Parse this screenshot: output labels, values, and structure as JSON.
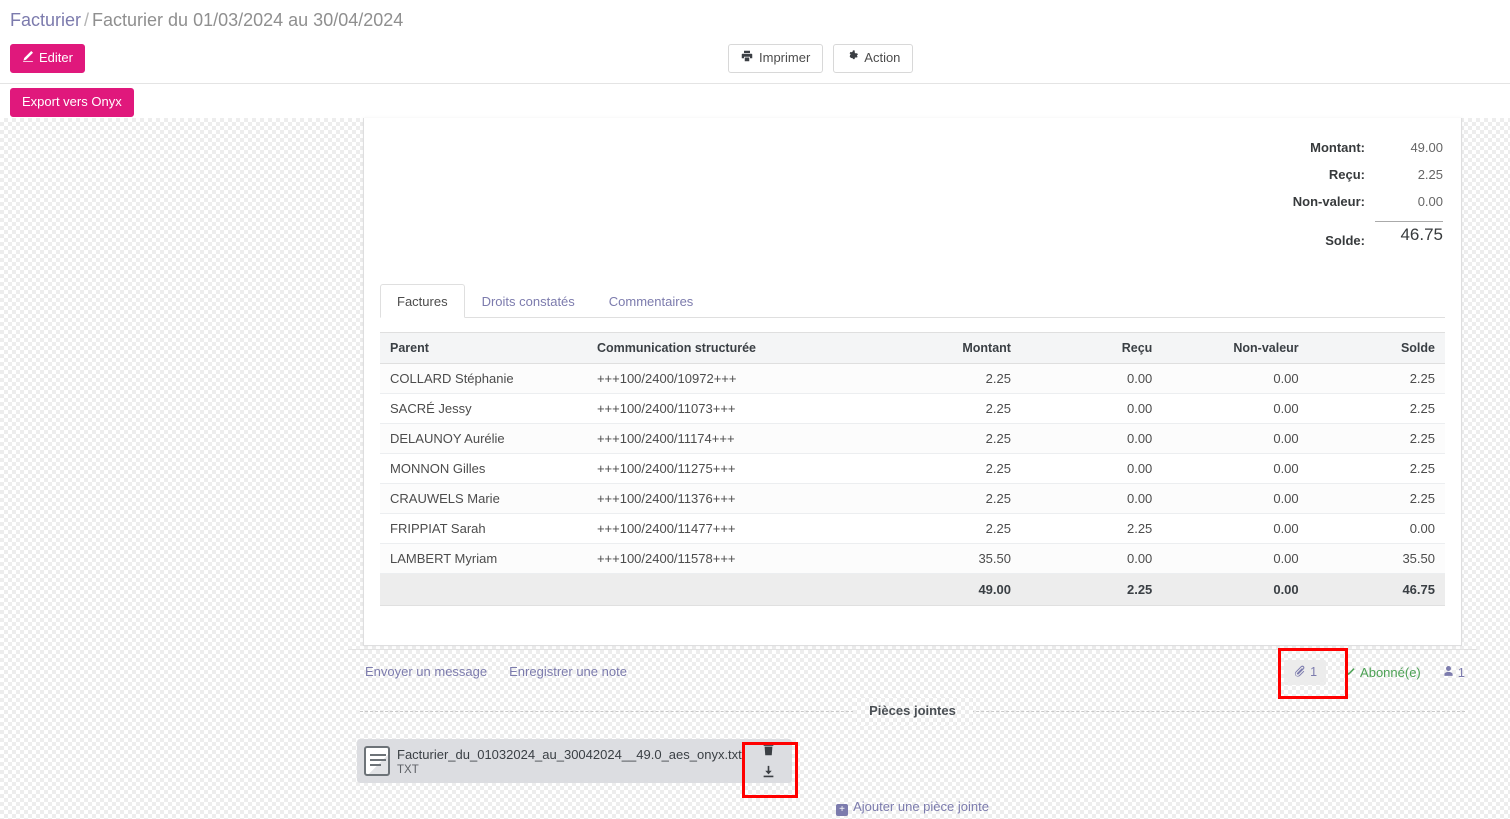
{
  "breadcrumb": {
    "root": "Facturier",
    "separator": "/",
    "current": "Facturier du 01/03/2024 au 30/04/2024"
  },
  "control_panel": {
    "edit_button": "Editer",
    "print_button": "Imprimer",
    "action_button": "Action",
    "export_button": "Export vers Onyx",
    "colors": {
      "primary_pink": "#e0187c",
      "link_purple": "#7c7bad",
      "annotation_red": "#ff0000"
    }
  },
  "summary": [
    {
      "label": "Montant:",
      "value": "49.00"
    },
    {
      "label": "Reçu:",
      "value": "2.25"
    },
    {
      "label": "Non-valeur:",
      "value": "0.00"
    },
    {
      "label": "Solde:",
      "value": "46.75"
    }
  ],
  "tabs": [
    {
      "label": "Factures",
      "active": true
    },
    {
      "label": "Droits constatés",
      "active": false
    },
    {
      "label": "Commentaires",
      "active": false
    }
  ],
  "table": {
    "columns": [
      "Parent",
      "Communication structurée",
      "Montant",
      "Reçu",
      "Non-valeur",
      "Solde"
    ],
    "rows": [
      {
        "parent": "COLLARD Stéphanie",
        "communication": "+++100/2400/10972+++",
        "montant": "2.25",
        "recu": "0.00",
        "non_valeur": "0.00",
        "solde": "2.25"
      },
      {
        "parent": "SACRÉ Jessy",
        "communication": "+++100/2400/11073+++",
        "montant": "2.25",
        "recu": "0.00",
        "non_valeur": "0.00",
        "solde": "2.25"
      },
      {
        "parent": "DELAUNOY Aurélie",
        "communication": "+++100/2400/11174+++",
        "montant": "2.25",
        "recu": "0.00",
        "non_valeur": "0.00",
        "solde": "2.25"
      },
      {
        "parent": "MONNON Gilles",
        "communication": "+++100/2400/11275+++",
        "montant": "2.25",
        "recu": "0.00",
        "non_valeur": "0.00",
        "solde": "2.25"
      },
      {
        "parent": "CRAUWELS Marie",
        "communication": "+++100/2400/11376+++",
        "montant": "2.25",
        "recu": "0.00",
        "non_valeur": "0.00",
        "solde": "2.25"
      },
      {
        "parent": "FRIPPIAT Sarah",
        "communication": "+++100/2400/11477+++",
        "montant": "2.25",
        "recu": "2.25",
        "non_valeur": "0.00",
        "solde": "0.00"
      },
      {
        "parent": "LAMBERT Myriam",
        "communication": "+++100/2400/11578+++",
        "montant": "35.50",
        "recu": "0.00",
        "non_valeur": "0.00",
        "solde": "35.50"
      }
    ],
    "totals": {
      "parent": "",
      "communication": "",
      "montant": "49.00",
      "recu": "2.25",
      "non_valeur": "0.00",
      "solde": "46.75"
    }
  },
  "chatter": {
    "send_message": "Envoyer un message",
    "log_note": "Enregistrer une note",
    "attachment_count": "1",
    "following_label": "Abonné(e)",
    "follower_count": "1"
  },
  "attachments": {
    "section_title": "Pièces jointes",
    "items": [
      {
        "name": "Facturier_du_01032024_au_30042024__49.0_aes_onyx.txt",
        "type": "TXT"
      }
    ],
    "add_label": "Ajouter une pièce jointe",
    "add_icon_symbol": "+"
  }
}
